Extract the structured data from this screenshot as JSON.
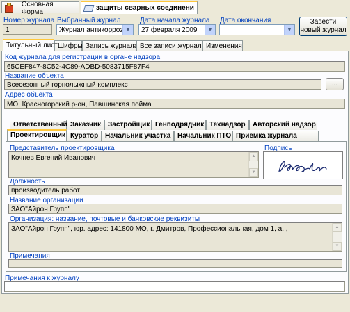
{
  "window_tabs": [
    {
      "label": "Основная Форма"
    },
    {
      "label": "защиты сварных соединени"
    }
  ],
  "header": {
    "journal_number_label": "Номер журнала",
    "journal_number_value": "1",
    "selected_journal_label": "Выбранный журнал",
    "selected_journal_value": "Журнал антикоррозио",
    "start_date_label": "Дата начала журнала",
    "start_date_value": "27 февраля  2009",
    "end_date_label": "Дата окончания",
    "end_date_value": "",
    "new_journal_button": "Завести новый журнал"
  },
  "main_tabs": [
    {
      "label": "Титульный лист"
    },
    {
      "label": "Шифры"
    },
    {
      "label": "Запись журнала"
    },
    {
      "label": "Все записи журнала"
    },
    {
      "label": "Изменения"
    }
  ],
  "title_page": {
    "reg_code_label": "Код журнала для регистрации в органе надзора",
    "reg_code_value": "65CEF847-8C52-4C89-ADBD-5083715F87F4",
    "object_name_label": "Название объекта",
    "object_name_value": "Всесезонный горнолыжный комплекс",
    "browse_button": "...",
    "object_address_label": "Адрес объекта",
    "object_address_value": "МО, Красногорский р-он, Павшинская пойма"
  },
  "party_tabs_row1": [
    {
      "label": "Ответственный"
    },
    {
      "label": "Заказчик"
    },
    {
      "label": "Застройщик"
    },
    {
      "label": "Генподрядчик"
    },
    {
      "label": "Технадзор"
    },
    {
      "label": "Авторский надзор"
    }
  ],
  "party_tabs_row2": [
    {
      "label": "Проектировщик"
    },
    {
      "label": "Куратор"
    },
    {
      "label": "Начальник участка"
    },
    {
      "label": "Начальник ПТО"
    },
    {
      "label": "Приемка журнала"
    }
  ],
  "designer": {
    "rep_label": "Представитель проектировщика",
    "rep_value": "Кочнев Евгений Иванович",
    "signature_label": "Подпись",
    "position_label": "Должность",
    "position_value": "производитель работ",
    "org_name_label": "Название организации",
    "org_name_value": "ЗАО\"Айрон Групп\"",
    "org_details_label": "Организация: название, почтовые и банковские реквизиты",
    "org_details_value": "ЗАО\"Айрон Групп\", юр. адрес: 141800 МО, г. Дмитров, Профессиональная, дом 1, а, ,",
    "notes_label": "Примечания",
    "notes_value": ""
  },
  "journal_notes": {
    "label": "Примечания к журналу",
    "value": ""
  },
  "colors": {
    "label_blue": "#0040c0",
    "field_bg": "#e8e5d6",
    "window_bg": "#ece9d8",
    "active_tab_accent": "#ffc83c"
  }
}
